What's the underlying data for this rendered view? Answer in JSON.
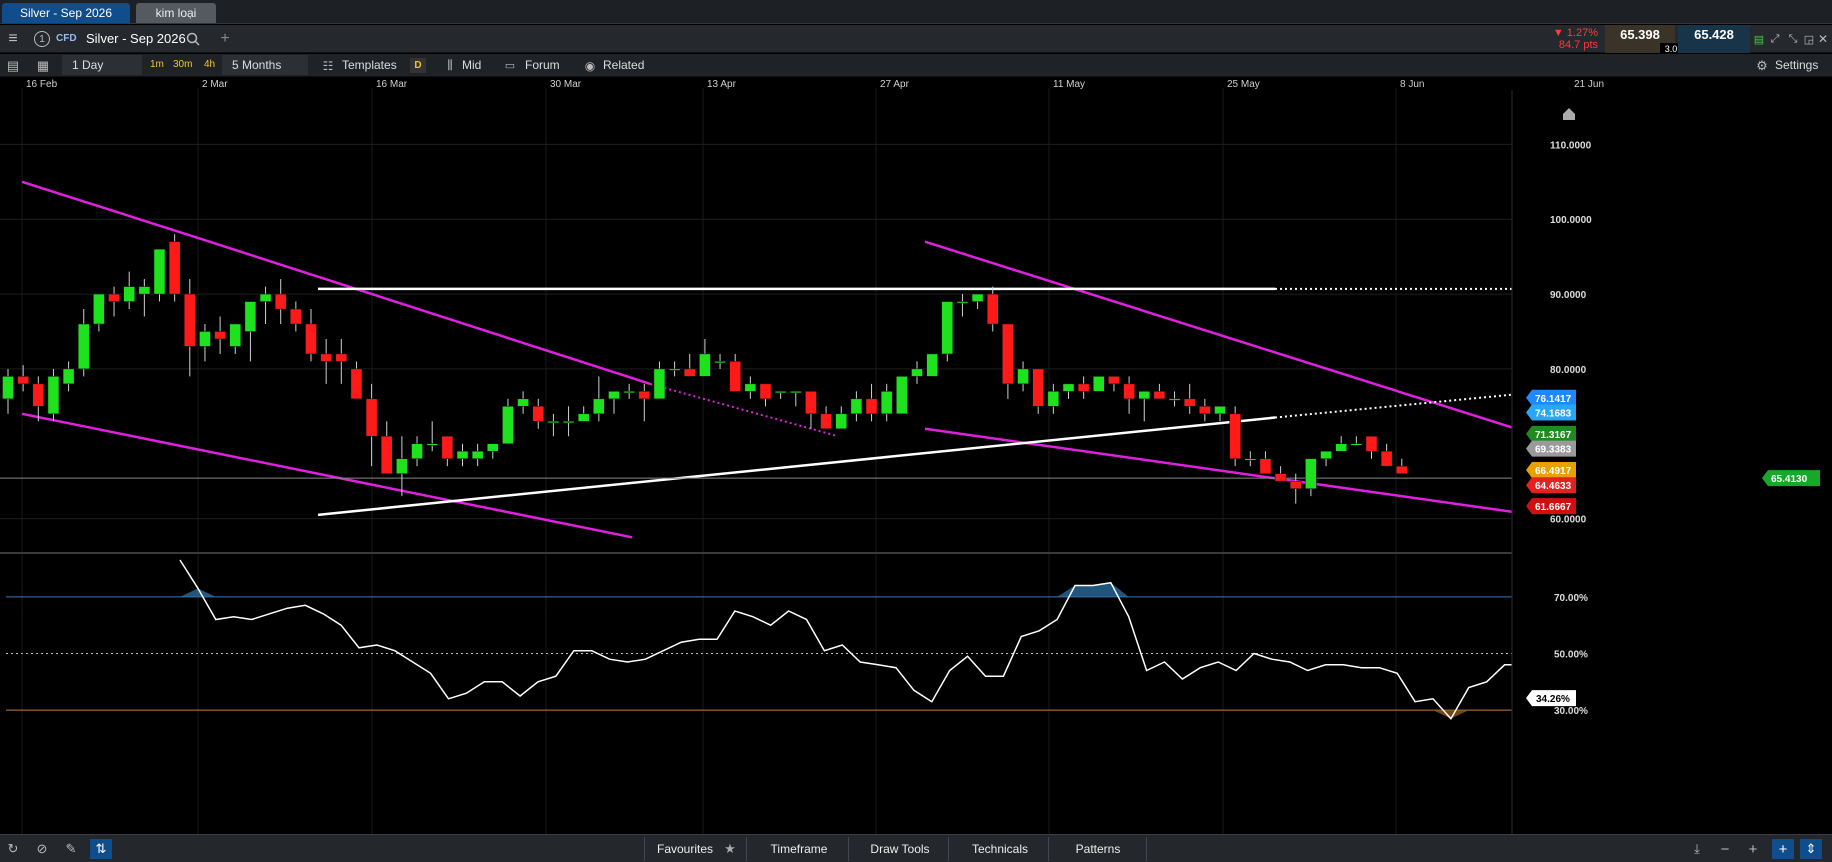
{
  "tabs": [
    {
      "label": "Silver - Sep 2026"
    },
    {
      "label": "kim loại"
    }
  ],
  "header": {
    "instrument_num": "1",
    "cfd_badge": "CFD",
    "instrument": "Silver - Sep 2026",
    "change_pct": "▼ 1.27%",
    "change_pts": "84.7 pts",
    "sell_price": "65.398",
    "spread": "3.0",
    "buy_price": "65.428"
  },
  "toolbar": {
    "interval": "1 Day",
    "quick_1": "1m",
    "quick_2": "30m",
    "quick_3": "4h",
    "range": "5 Months",
    "templates": "Templates",
    "d_badge": "D",
    "mid": "Mid",
    "forum": "Forum",
    "related": "Related",
    "settings": "Settings"
  },
  "chart_data": [
    {
      "type": "candlestick",
      "date_labels": [
        "16 Feb",
        "2 Mar",
        "16 Mar",
        "30 Mar",
        "13 Apr",
        "27 Apr",
        "11 May",
        "25 May",
        "8 Jun",
        "21 Jun"
      ],
      "y_ticks": [
        "110.0000",
        "100.0000",
        "90.0000",
        "80.0000",
        "60.0000"
      ],
      "ylim": [
        55,
        117
      ],
      "candles": [
        {
          "o": 76,
          "h": 80,
          "l": 74,
          "c": 79
        },
        {
          "o": 79,
          "h": 80.5,
          "l": 77,
          "c": 78
        },
        {
          "o": 78,
          "h": 79,
          "l": 73,
          "c": 75
        },
        {
          "o": 74,
          "h": 80,
          "l": 73,
          "c": 79
        },
        {
          "o": 78,
          "h": 81,
          "l": 77,
          "c": 80
        },
        {
          "o": 80,
          "h": 88,
          "l": 79,
          "c": 86
        },
        {
          "o": 86,
          "h": 90,
          "l": 85,
          "c": 90
        },
        {
          "o": 90,
          "h": 91,
          "l": 87,
          "c": 89
        },
        {
          "o": 89,
          "h": 93,
          "l": 88,
          "c": 91
        },
        {
          "o": 90,
          "h": 92,
          "l": 87,
          "c": 91
        },
        {
          "o": 90,
          "h": 96,
          "l": 89,
          "c": 96
        },
        {
          "o": 97,
          "h": 98,
          "l": 89,
          "c": 90
        },
        {
          "o": 90,
          "h": 92,
          "l": 79,
          "c": 83
        },
        {
          "o": 83,
          "h": 86,
          "l": 81,
          "c": 85
        },
        {
          "o": 85,
          "h": 87,
          "l": 82,
          "c": 84
        },
        {
          "o": 83,
          "h": 86,
          "l": 82,
          "c": 86
        },
        {
          "o": 85,
          "h": 89,
          "l": 81,
          "c": 89
        },
        {
          "o": 89,
          "h": 91,
          "l": 86,
          "c": 90
        },
        {
          "o": 90,
          "h": 92,
          "l": 86,
          "c": 88
        },
        {
          "o": 88,
          "h": 89,
          "l": 85,
          "c": 86
        },
        {
          "o": 86,
          "h": 88,
          "l": 81,
          "c": 82
        },
        {
          "o": 82,
          "h": 84,
          "l": 78,
          "c": 81
        },
        {
          "o": 82,
          "h": 84,
          "l": 78,
          "c": 81
        },
        {
          "o": 80,
          "h": 81,
          "l": 76,
          "c": 76
        },
        {
          "o": 76,
          "h": 78,
          "l": 67,
          "c": 71
        },
        {
          "o": 71,
          "h": 73,
          "l": 66,
          "c": 66
        },
        {
          "o": 66,
          "h": 71,
          "l": 63,
          "c": 68
        },
        {
          "o": 68,
          "h": 71,
          "l": 67,
          "c": 70
        },
        {
          "o": 70,
          "h": 73,
          "l": 69,
          "c": 70
        },
        {
          "o": 71,
          "h": 71,
          "l": 67,
          "c": 68
        },
        {
          "o": 68,
          "h": 70,
          "l": 67,
          "c": 69
        },
        {
          "o": 68,
          "h": 70,
          "l": 67,
          "c": 69
        },
        {
          "o": 69,
          "h": 70,
          "l": 68,
          "c": 70
        },
        {
          "o": 70,
          "h": 76,
          "l": 70,
          "c": 75
        },
        {
          "o": 75,
          "h": 77,
          "l": 74,
          "c": 76
        },
        {
          "o": 75,
          "h": 76,
          "l": 72,
          "c": 73
        },
        {
          "o": 73,
          "h": 74,
          "l": 71,
          "c": 73
        },
        {
          "o": 73,
          "h": 75,
          "l": 71,
          "c": 73
        },
        {
          "o": 73,
          "h": 75,
          "l": 73,
          "c": 74
        },
        {
          "o": 74,
          "h": 79,
          "l": 73,
          "c": 76
        },
        {
          "o": 76,
          "h": 77,
          "l": 74,
          "c": 77
        },
        {
          "o": 77,
          "h": 78,
          "l": 76,
          "c": 77
        },
        {
          "o": 77,
          "h": 78,
          "l": 73,
          "c": 76
        },
        {
          "o": 76,
          "h": 81,
          "l": 76,
          "c": 80
        },
        {
          "o": 80,
          "h": 81,
          "l": 79,
          "c": 80
        },
        {
          "o": 80,
          "h": 82,
          "l": 79,
          "c": 79
        },
        {
          "o": 79,
          "h": 84,
          "l": 79,
          "c": 82
        },
        {
          "o": 81,
          "h": 82,
          "l": 80,
          "c": 81
        },
        {
          "o": 81,
          "h": 82,
          "l": 77,
          "c": 77
        },
        {
          "o": 77,
          "h": 79,
          "l": 76,
          "c": 78
        },
        {
          "o": 78,
          "h": 78,
          "l": 75,
          "c": 76
        },
        {
          "o": 77,
          "h": 77,
          "l": 76,
          "c": 77
        },
        {
          "o": 77,
          "h": 77,
          "l": 75,
          "c": 77
        },
        {
          "o": 77,
          "h": 77,
          "l": 72,
          "c": 74
        },
        {
          "o": 74,
          "h": 75,
          "l": 72,
          "c": 72
        },
        {
          "o": 72,
          "h": 75,
          "l": 72,
          "c": 74
        },
        {
          "o": 74,
          "h": 77,
          "l": 73,
          "c": 76
        },
        {
          "o": 76,
          "h": 78,
          "l": 73,
          "c": 74
        },
        {
          "o": 74,
          "h": 78,
          "l": 73,
          "c": 77
        },
        {
          "o": 74,
          "h": 79,
          "l": 74,
          "c": 79
        },
        {
          "o": 79,
          "h": 81,
          "l": 78,
          "c": 80
        },
        {
          "o": 79,
          "h": 82,
          "l": 79,
          "c": 82
        },
        {
          "o": 82,
          "h": 89,
          "l": 81,
          "c": 89
        },
        {
          "o": 89,
          "h": 90,
          "l": 87,
          "c": 89
        },
        {
          "o": 89,
          "h": 90,
          "l": 88,
          "c": 90
        },
        {
          "o": 90,
          "h": 91,
          "l": 85,
          "c": 86
        },
        {
          "o": 86,
          "h": 86,
          "l": 76,
          "c": 78
        },
        {
          "o": 78,
          "h": 81,
          "l": 77,
          "c": 80
        },
        {
          "o": 80,
          "h": 80,
          "l": 74,
          "c": 75
        },
        {
          "o": 75,
          "h": 78,
          "l": 74,
          "c": 77
        },
        {
          "o": 77,
          "h": 78,
          "l": 76,
          "c": 78
        },
        {
          "o": 78,
          "h": 79,
          "l": 76,
          "c": 77
        },
        {
          "o": 77,
          "h": 79,
          "l": 77,
          "c": 79
        },
        {
          "o": 79,
          "h": 79,
          "l": 77,
          "c": 78
        },
        {
          "o": 78,
          "h": 79,
          "l": 74,
          "c": 76
        },
        {
          "o": 76,
          "h": 77,
          "l": 73,
          "c": 77
        },
        {
          "o": 77,
          "h": 78,
          "l": 76,
          "c": 76
        },
        {
          "o": 76,
          "h": 77,
          "l": 75,
          "c": 76
        },
        {
          "o": 76,
          "h": 78,
          "l": 74,
          "c": 75
        },
        {
          "o": 75,
          "h": 76,
          "l": 73,
          "c": 74
        },
        {
          "o": 74,
          "h": 75,
          "l": 73,
          "c": 75
        },
        {
          "o": 74,
          "h": 75,
          "l": 67,
          "c": 68
        },
        {
          "o": 68,
          "h": 69,
          "l": 67,
          "c": 68
        },
        {
          "o": 68,
          "h": 69,
          "l": 66,
          "c": 66
        },
        {
          "o": 66,
          "h": 67,
          "l": 65,
          "c": 65
        },
        {
          "o": 65,
          "h": 66,
          "l": 62,
          "c": 64
        },
        {
          "o": 64,
          "h": 68,
          "l": 63,
          "c": 68
        },
        {
          "o": 68,
          "h": 69,
          "l": 67,
          "c": 69
        },
        {
          "o": 69,
          "h": 71,
          "l": 69,
          "c": 70
        },
        {
          "o": 70,
          "h": 71,
          "l": 70,
          "c": 70
        },
        {
          "o": 71,
          "h": 71,
          "l": 68,
          "c": 69
        },
        {
          "o": 69,
          "h": 70,
          "l": 67,
          "c": 67
        },
        {
          "o": 67,
          "h": 68,
          "l": 66,
          "c": 66
        }
      ],
      "price_tags": [
        {
          "label": "76.1417",
          "color": "#1e88ff"
        },
        {
          "label": "74.1683",
          "color": "#27a7f5"
        },
        {
          "label": "71.3167",
          "color": "#1f8a1f"
        },
        {
          "label": "69.3383",
          "color": "#9a9a9a"
        },
        {
          "label": "66.4917",
          "color": "#e6a000"
        },
        {
          "label": "65.4130",
          "color": "#17a82a"
        },
        {
          "label": "64.4633",
          "color": "#e52020"
        },
        {
          "label": "61.6667",
          "color": "#d01010"
        }
      ]
    },
    {
      "type": "line",
      "name": "oscillator",
      "y_ticks": [
        "70.00%",
        "50.00%",
        "30.00%"
      ],
      "current": "34.26%",
      "ylim": [
        23,
        83
      ],
      "levels": [
        70,
        50,
        30
      ],
      "values": [
        83,
        73,
        62,
        63,
        62,
        64,
        66,
        67,
        64,
        60,
        52,
        53,
        51,
        47,
        43,
        34,
        36,
        40,
        40,
        35,
        40,
        42,
        51,
        51,
        48,
        47,
        48,
        51,
        54,
        55,
        55,
        65,
        63,
        60,
        65,
        62,
        51,
        53,
        47,
        46,
        45,
        37,
        33,
        44,
        49,
        42,
        42,
        56,
        58,
        62,
        74,
        74,
        75,
        63,
        44,
        47,
        41,
        45,
        47,
        44,
        50,
        48,
        47,
        44,
        46,
        46,
        45,
        45,
        43,
        33,
        34,
        27,
        38,
        40,
        46,
        46,
        41,
        37,
        36
      ]
    }
  ],
  "bottom": {
    "favourites": "Favourites",
    "timeframe": "Timeframe",
    "draw_tools": "Draw Tools",
    "technicals": "Technicals",
    "patterns": "Patterns"
  },
  "colors": {
    "up": "#1fe21f",
    "down": "#ff1a1a",
    "trendline": "#e020e0",
    "support": "#ffffff",
    "panel": "#1d2024",
    "accent": "#0f4d8c"
  }
}
